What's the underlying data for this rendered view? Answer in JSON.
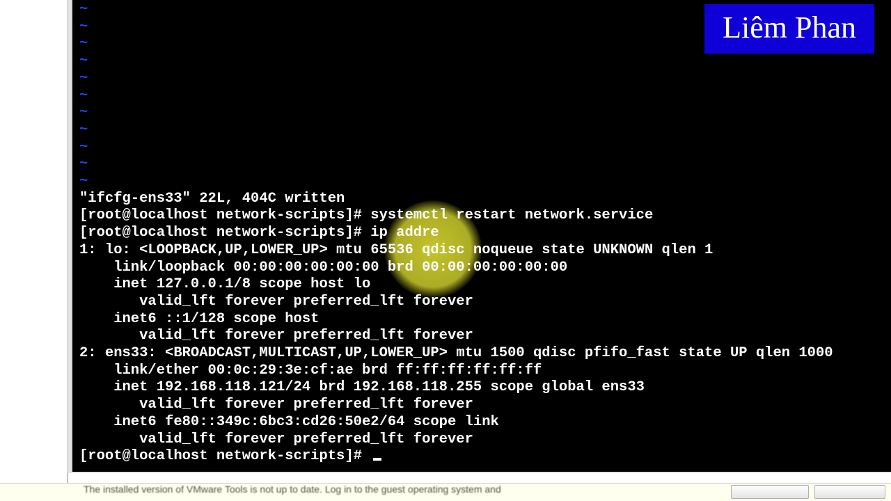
{
  "watermark": "Liêm Phan",
  "tilde": "~",
  "terminal": {
    "vim_msg": "\"ifcfg-ens33\" 22L, 404C written",
    "prompt": "[root@localhost network-scripts]#",
    "cmd1": "systemctl restart network.service",
    "cmd2": "ip addre",
    "out": {
      "l1": "1: lo: <LOOPBACK,UP,LOWER_UP> mtu 65536 qdisc noqueue state UNKNOWN qlen 1",
      "l2": "    link/loopback 00:00:00:00:00:00 brd 00:00:00:00:00:00",
      "l3": "    inet 127.0.0.1/8 scope host lo",
      "l4": "       valid_lft forever preferred_lft forever",
      "l5": "    inet6 ::1/128 scope host",
      "l6": "       valid_lft forever preferred_lft forever",
      "l7": "2: ens33: <BROADCAST,MULTICAST,UP,LOWER_UP> mtu 1500 qdisc pfifo_fast state UP qlen 1000",
      "l8": "    link/ether 00:0c:29:3e:cf:ae brd ff:ff:ff:ff:ff:ff",
      "l9": "    inet 192.168.118.121/24 brd 192.168.118.255 scope global ens33",
      "l10": "       valid_lft forever preferred_lft forever",
      "l11": "    inet6 fe80::349c:6bc3:cd26:50e2/64 scope link",
      "l12": "       valid_lft forever preferred_lft forever"
    }
  },
  "status": {
    "text": "The installed version of VMware Tools is not up to date. Log in to the guest operating system and"
  }
}
